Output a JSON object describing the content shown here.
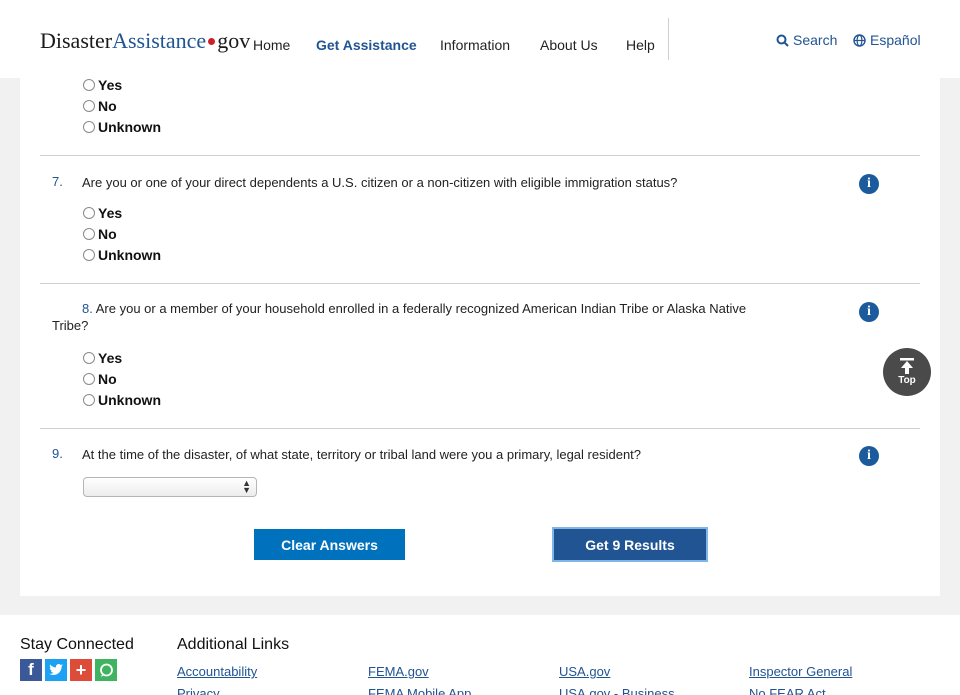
{
  "header": {
    "logo": {
      "part1": "Disaster",
      "part2": "Assistance",
      "part3": "gov"
    },
    "nav": [
      "Home",
      "Get Assistance",
      "Information",
      "About Us",
      "Help"
    ],
    "active_nav": "Get Assistance",
    "search_label": "Search",
    "language_label": "Español"
  },
  "questions": [
    {
      "number": "",
      "text": "",
      "options": [
        "Yes",
        "No",
        "Unknown"
      ]
    },
    {
      "number": "7.",
      "text": "Are you or one of your direct dependents a U.S. citizen or a non-citizen with eligible immigration status?",
      "options": [
        "Yes",
        "No",
        "Unknown"
      ]
    },
    {
      "number": "8.",
      "text": "Are you or a member of your household enrolled in a federally recognized American Indian Tribe or Alaska Native Tribe?",
      "options": [
        "Yes",
        "No",
        "Unknown"
      ]
    },
    {
      "number": "9.",
      "text": "At the time of the disaster, of what state, territory or tribal land were you a primary, legal resident?",
      "select_value": ""
    }
  ],
  "buttons": {
    "clear": "Clear Answers",
    "results": "Get 9 Results"
  },
  "top_button": "Top",
  "footer": {
    "stay_connected": "Stay Connected",
    "additional_links": "Additional Links",
    "social": [
      "facebook",
      "twitter",
      "google-plus",
      "chat"
    ],
    "links_row1": [
      "Accountability",
      "FEMA.gov",
      "USA.gov",
      "Inspector General"
    ],
    "links_row2": [
      "Privacy",
      "FEMA Mobile App",
      "USA.gov - Business",
      "No FEAR Act"
    ]
  },
  "colors": {
    "brand_blue": "#205493",
    "button_blue": "#0071bc",
    "logo_dot": "#cd2026",
    "info_blue": "#1b5a9b"
  }
}
